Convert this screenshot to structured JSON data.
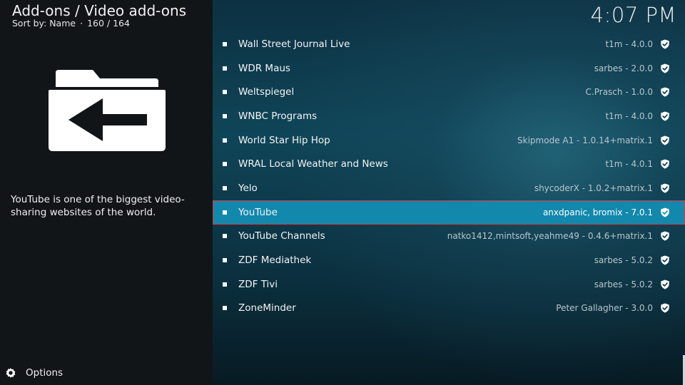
{
  "header": {
    "title": "Add-ons / Video add-ons",
    "sort_label": "Sort by: Name",
    "position": "160 / 164"
  },
  "clock": "4:07 PM",
  "sidebar": {
    "icon": "folder-back-arrow-icon",
    "description": "YouTube is one of the biggest video-sharing websites of the world.",
    "options_label": "Options",
    "options_icon": "gear-icon"
  },
  "colors": {
    "selection": "#1388ad",
    "selection_outline": "#e0353a",
    "left_panel": "#121518"
  },
  "list": {
    "items": [
      {
        "name": "Wall Street Journal Live",
        "meta": "t1m - 4.0.0"
      },
      {
        "name": "WDR Maus",
        "meta": "sarbes - 2.0.0"
      },
      {
        "name": "Weltspiegel",
        "meta": "C.Prasch - 1.0.0"
      },
      {
        "name": "WNBC Programs",
        "meta": "t1m - 4.0.0"
      },
      {
        "name": "World Star Hip Hop",
        "meta": "Skipmode A1 - 1.0.14+matrix.1"
      },
      {
        "name": "WRAL Local Weather and News",
        "meta": "t1m - 4.0.1"
      },
      {
        "name": "Yelo",
        "meta": "shycoderX - 1.0.2+matrix.1"
      },
      {
        "name": "YouTube",
        "meta": "anxdpanic, bromix - 7.0.1",
        "selected": true
      },
      {
        "name": "YouTube Channels",
        "meta": "natko1412,mintsoft,yeahme49 - 0.4.6+matrix.1"
      },
      {
        "name": "ZDF Mediathek",
        "meta": "sarbes - 5.0.2"
      },
      {
        "name": "ZDF Tivi",
        "meta": "sarbes - 5.0.2"
      },
      {
        "name": "ZoneMinder",
        "meta": "Peter Gallagher - 3.0.0"
      }
    ]
  }
}
